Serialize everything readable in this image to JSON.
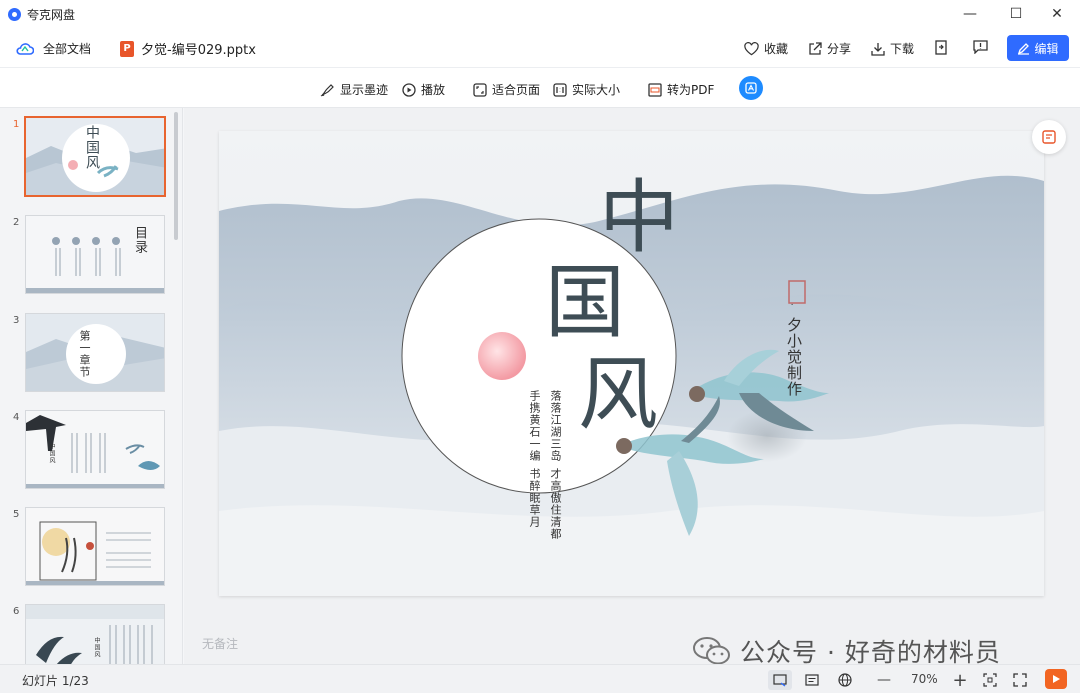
{
  "window": {
    "app_title": "夸克网盘",
    "minimize": "—",
    "maximize": "☐",
    "close": "✕"
  },
  "toolbar": {
    "all_docs": "全部文档",
    "file_name": "夕觉-编号029.pptx",
    "ppt_badge": "P",
    "favorite": "收藏",
    "share": "分享",
    "download": "下载",
    "edit": "编辑"
  },
  "viewbar": {
    "show_ink": "显示墨迹",
    "play": "播放",
    "fit_page": "适合页面",
    "actual_size": "实际大小",
    "to_pdf": "转为PDF"
  },
  "thumbs": {
    "numbers": [
      "1",
      "2",
      "3",
      "4",
      "5",
      "6"
    ],
    "t1_title": "中国风",
    "t2_title": "目录",
    "t3_title": "第一章节",
    "t4_title": "中国风",
    "t6_title": "中国风"
  },
  "slide": {
    "title_chars": [
      "中",
      "国",
      "风"
    ],
    "author": "夕小觉制作",
    "dot": "·",
    "col1": "落落江湖三岛",
    "col2": "才高傲住清都",
    "col3": "手携黄石一编",
    "col4": "书醉眠草月"
  },
  "notes_placeholder": "无备注",
  "watermark": "公众号 · 好奇的材料员",
  "status": {
    "slide_counter": "幻灯片 1/23",
    "zoom_minus": "—",
    "zoom": "70%",
    "zoom_plus": "+"
  },
  "colors": {
    "accent": "#2f6bff",
    "active_thumb": "#e8642f",
    "title_ink": "#3e4d55",
    "play": "#f26522"
  }
}
